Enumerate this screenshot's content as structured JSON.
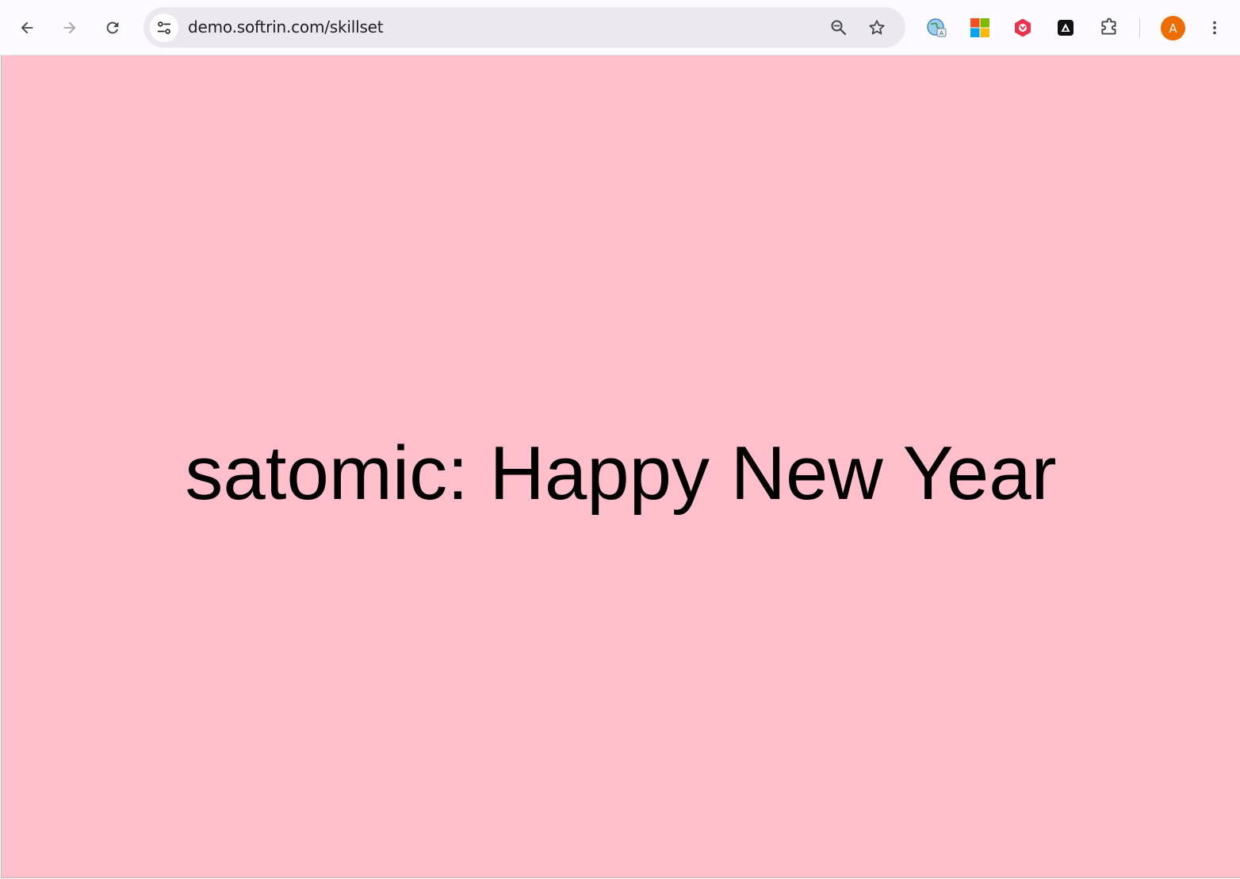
{
  "browser": {
    "url": "demo.softrin.com/skillset",
    "profile_initial": "A",
    "icons": {
      "back": "back-arrow-icon",
      "forward": "forward-arrow-icon",
      "reload": "reload-icon",
      "site_info": "site-settings-icon",
      "zoom": "zoom-icon",
      "bookmark": "star-icon",
      "extension_1": "translate-globe-icon",
      "extension_2": "microsoft-logo-icon",
      "extension_3": "red-shield-extension-icon",
      "extension_4": "black-triangle-extension-icon",
      "extensions_menu": "puzzle-piece-icon",
      "more_menu": "vertical-dots-icon"
    },
    "colors": {
      "toolbar_bg": "#fdfbff",
      "omnibox_bg": "#ebe8f0",
      "avatar_bg": "#ef6c00"
    }
  },
  "page": {
    "background": "#ffc0cb",
    "message": "satomic: Happy New Year"
  }
}
